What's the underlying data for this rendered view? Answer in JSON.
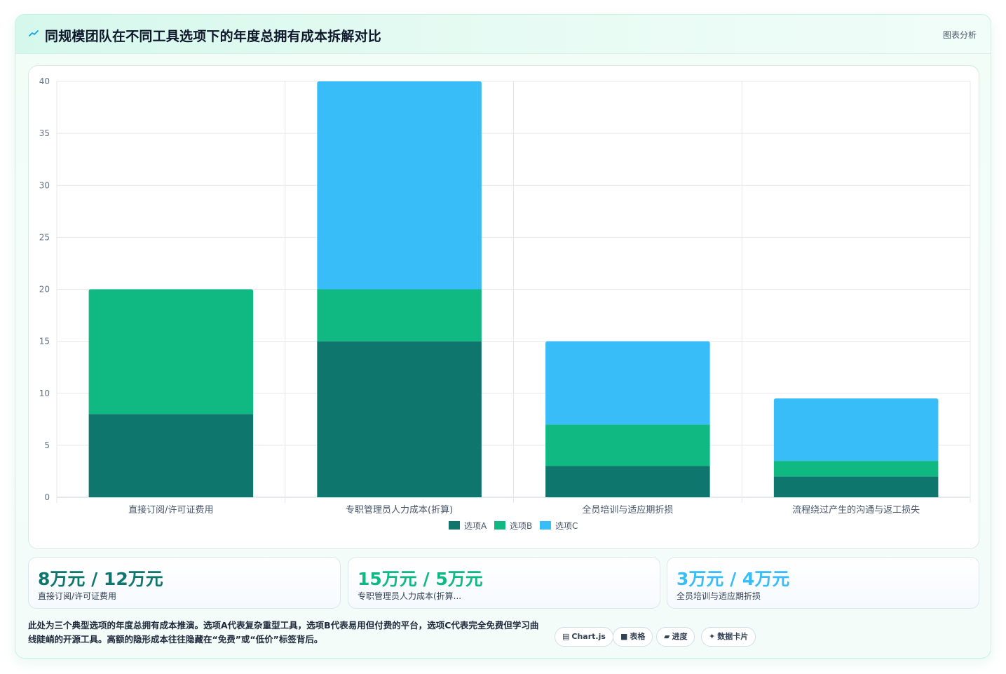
{
  "header": {
    "title": "同规模团队在不同工具选项下的年度总拥有成本拆解对比",
    "tag": "图表分析",
    "icon": "trend-icon"
  },
  "chart_data": {
    "type": "bar",
    "stacked": true,
    "categories": [
      "直接订阅/许可证费用",
      "专职管理员人力成本(折算)",
      "全员培训与适应期折损",
      "流程绕过产生的沟通与返工损失"
    ],
    "series": [
      {
        "name": "选项A",
        "values": [
          8,
          15,
          3,
          2
        ],
        "color": "#0f766e"
      },
      {
        "name": "选项B",
        "values": [
          12,
          5,
          4,
          1.5
        ],
        "color": "#10b981"
      },
      {
        "name": "选项C",
        "values": [
          0,
          20,
          8,
          6
        ],
        "color": "#38bdf8"
      }
    ],
    "ylim": [
      0,
      40
    ],
    "yticks": [
      0,
      5,
      10,
      15,
      20,
      25,
      30,
      35,
      40
    ],
    "grid": true,
    "legend": "bottom"
  },
  "stats": [
    {
      "value": "8万元 / 12万元",
      "label": "直接订阅/许可证费用",
      "color": "#0f766e"
    },
    {
      "value": "15万元 / 5万元",
      "label": "专职管理员人力成本(折算...",
      "color": "#10b981"
    },
    {
      "value": "3万元 / 4万元",
      "label": "全员培训与适应期折损",
      "color": "#38bdf8"
    }
  ],
  "footer": {
    "note": "此处为三个典型选项的年度总拥有成本推演。选项A代表复杂重型工具，选项B代表易用但付费的平台，选项C代表完全免费但学习曲线陡峭的开源工具。高额的隐形成本往往隐藏在“免费”或“低价”标签背后。",
    "chips": [
      {
        "icon": "chart-icon",
        "glyph": "▤",
        "label": "Chart.js"
      },
      {
        "icon": "table-icon",
        "glyph": "■",
        "label": "表格"
      },
      {
        "icon": "progress-icon",
        "glyph": "▰",
        "label": "进度"
      },
      {
        "icon": "sparkle-icon",
        "glyph": "✦",
        "label": "数据卡片"
      }
    ]
  }
}
